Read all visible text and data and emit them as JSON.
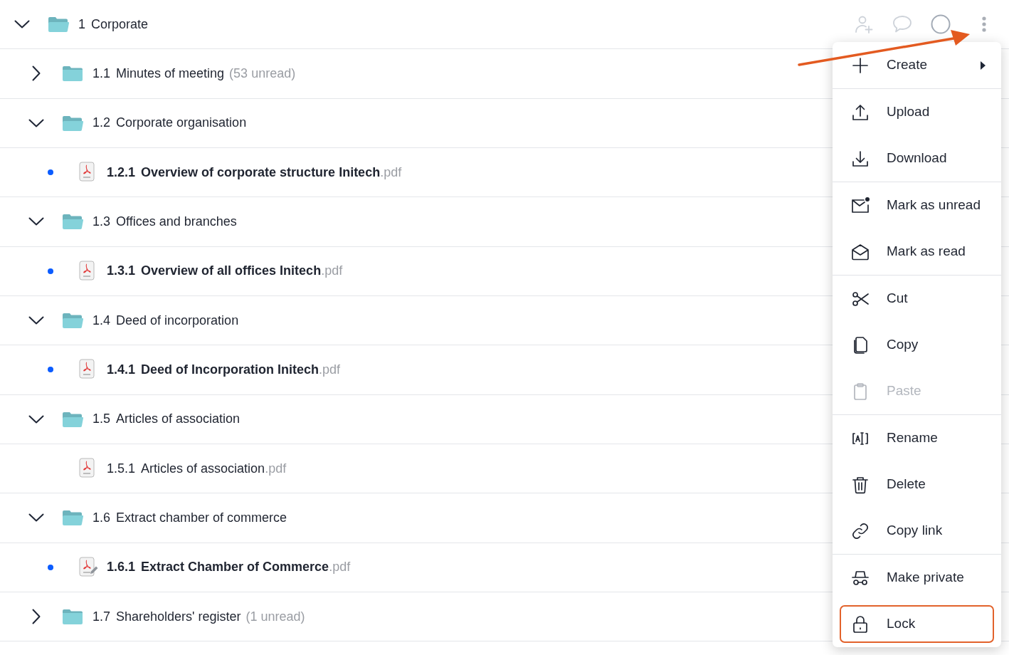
{
  "tree": [
    {
      "kind": "folder",
      "number": "1",
      "name": "Corporate",
      "expanded": true,
      "children": [
        {
          "kind": "folder",
          "number": "1.1",
          "name": "Minutes of meeting",
          "unread_count": "(53 unread)",
          "expanded": false
        },
        {
          "kind": "folder",
          "number": "1.2",
          "name": "Corporate organisation",
          "expanded": true,
          "children": [
            {
              "kind": "file",
              "number": "1.2.1",
              "name": "Overview of corporate structure Initech",
              "extension": ".pdf",
              "unread": true,
              "edited": false
            }
          ]
        },
        {
          "kind": "folder",
          "number": "1.3",
          "name": "Offices and branches",
          "expanded": true,
          "children": [
            {
              "kind": "file",
              "number": "1.3.1",
              "name": "Overview of all offices Initech",
              "extension": ".pdf",
              "unread": true,
              "edited": false
            }
          ]
        },
        {
          "kind": "folder",
          "number": "1.4",
          "name": "Deed of incorporation",
          "expanded": true,
          "children": [
            {
              "kind": "file",
              "number": "1.4.1",
              "name": "Deed of Incorporation Initech",
              "extension": ".pdf",
              "unread": true,
              "edited": false
            }
          ]
        },
        {
          "kind": "folder",
          "number": "1.5",
          "name": "Articles of association",
          "expanded": true,
          "children": [
            {
              "kind": "file",
              "number": "1.5.1",
              "name": "Articles of association",
              "extension": ".pdf",
              "unread": false,
              "edited": false
            }
          ]
        },
        {
          "kind": "folder",
          "number": "1.6",
          "name": "Extract chamber of commerce",
          "expanded": true,
          "children": [
            {
              "kind": "file",
              "number": "1.6.1",
              "name": "Extract Chamber of Commerce",
              "extension": ".pdf",
              "unread": true,
              "edited": true
            }
          ]
        },
        {
          "kind": "folder",
          "number": "1.7",
          "name": "Shareholders' register",
          "unread_count": "(1 unread)",
          "expanded": false
        }
      ]
    }
  ],
  "context_menu": {
    "groups": [
      {
        "items": [
          {
            "label": "Create",
            "has_submenu": true,
            "disabled": false,
            "focused": false
          }
        ]
      },
      {
        "items": [
          {
            "label": "Upload",
            "has_submenu": false,
            "disabled": false,
            "focused": false
          },
          {
            "label": "Download",
            "has_submenu": false,
            "disabled": false,
            "focused": false
          }
        ]
      },
      {
        "items": [
          {
            "label": "Mark as unread",
            "has_submenu": false,
            "disabled": false,
            "focused": false
          },
          {
            "label": "Mark as read",
            "has_submenu": false,
            "disabled": false,
            "focused": false
          }
        ]
      },
      {
        "items": [
          {
            "label": "Cut",
            "has_submenu": false,
            "disabled": false,
            "focused": false
          },
          {
            "label": "Copy",
            "has_submenu": false,
            "disabled": false,
            "focused": false
          },
          {
            "label": "Paste",
            "has_submenu": false,
            "disabled": true,
            "focused": false
          }
        ]
      },
      {
        "items": [
          {
            "label": "Rename",
            "has_submenu": false,
            "disabled": false,
            "focused": false
          },
          {
            "label": "Delete",
            "has_submenu": false,
            "disabled": false,
            "focused": false
          },
          {
            "label": "Copy link",
            "has_submenu": false,
            "disabled": false,
            "focused": false
          }
        ]
      },
      {
        "items": [
          {
            "label": "Make private",
            "has_submenu": false,
            "disabled": false,
            "focused": false
          },
          {
            "label": "Lock",
            "has_submenu": false,
            "disabled": false,
            "focused": true
          }
        ]
      }
    ]
  }
}
